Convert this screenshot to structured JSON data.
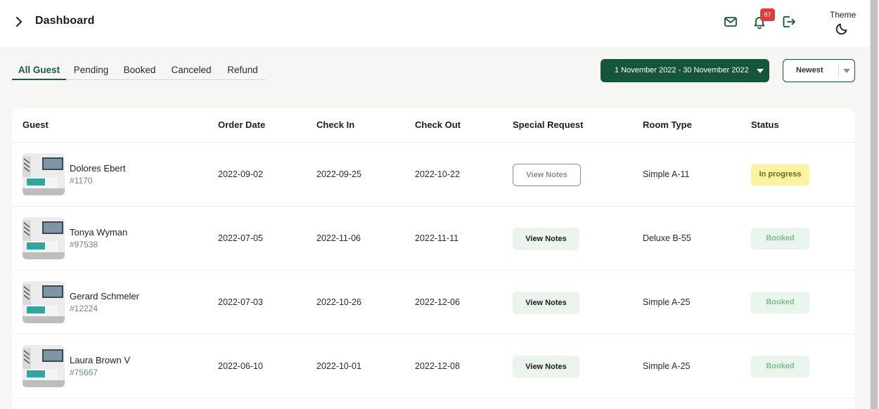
{
  "header": {
    "title": "Dashboard",
    "notification_count": "87",
    "theme_label": "Theme"
  },
  "tabs": [
    {
      "label": "All Guest",
      "active": true
    },
    {
      "label": "Pending",
      "active": false
    },
    {
      "label": "Booked",
      "active": false
    },
    {
      "label": "Canceled",
      "active": false
    },
    {
      "label": "Refund",
      "active": false
    }
  ],
  "filters": {
    "date_range": "1 November 2022 - 30 November 2022",
    "sort": "Newest"
  },
  "table": {
    "columns": [
      "Guest",
      "Order Date",
      "Check In",
      "Check Out",
      "Special Request",
      "Room Type",
      "Status"
    ],
    "rows": [
      {
        "name": "Dolores Ebert",
        "id": "#1170",
        "order_date": "2022-09-02",
        "check_in": "2022-09-25",
        "check_out": "2022-10-22",
        "request": "View Notes",
        "request_style": "outline",
        "room": "Simple A-11",
        "status": "In progress",
        "status_style": "progress"
      },
      {
        "name": "Tonya Wyman",
        "id": "#97538",
        "order_date": "2022-07-05",
        "check_in": "2022-11-06",
        "check_out": "2022-11-11",
        "request": "View Notes",
        "request_style": "filled",
        "room": "Deluxe B-55",
        "status": "Booked",
        "status_style": "booked"
      },
      {
        "name": "Gerard Schmeler",
        "id": "#12224",
        "order_date": "2022-07-03",
        "check_in": "2022-10-26",
        "check_out": "2022-12-06",
        "request": "View Notes",
        "request_style": "filled",
        "room": "Simple A-25",
        "status": "Booked",
        "status_style": "booked"
      },
      {
        "name": "Laura Brown V",
        "id": "#75667",
        "order_date": "2022-06-10",
        "check_in": "2022-10-01",
        "check_out": "2022-12-08",
        "request": "View Notes",
        "request_style": "filled",
        "room": "Simple A-25",
        "status": "Booked",
        "status_style": "booked"
      }
    ]
  },
  "colors": {
    "brand": "#15553a",
    "badge": "#e03c3c",
    "in_progress_bg": "#faf3a0",
    "booked_bg": "#e9f5ec"
  }
}
